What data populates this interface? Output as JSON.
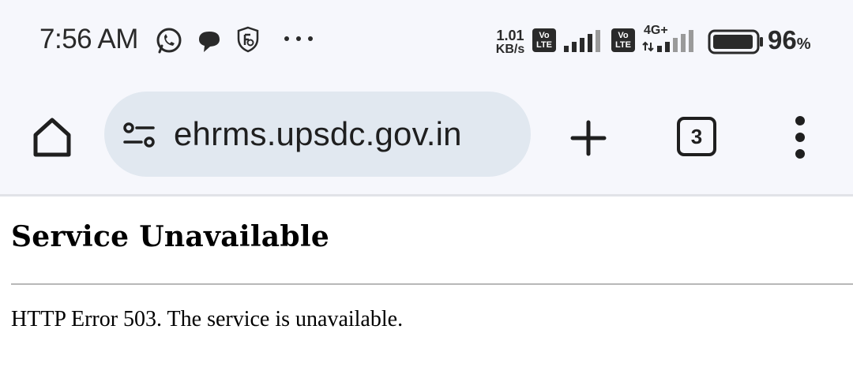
{
  "status_bar": {
    "time": "7:56 AM",
    "notification_icons": [
      "whatsapp-icon",
      "chat-bubble-icon",
      "shield-icon",
      "more-notifications-icon"
    ],
    "network_speed_value": "1.01",
    "network_speed_unit": "KB/s",
    "sim1_badge_top": "Vo",
    "sim1_badge_bottom": "LTE",
    "sim2_badge_top": "Vo",
    "sim2_badge_bottom": "LTE",
    "sim2_network_type": "4G+",
    "battery_level": 96,
    "battery_value": "96",
    "battery_unit": "%"
  },
  "toolbar": {
    "url": "ehrms.upsdc.gov.in",
    "tab_count": "3",
    "icons": [
      "home-icon",
      "site-settings-icon",
      "plus-icon",
      "more-vert-icon"
    ]
  },
  "page": {
    "title": "Service Unavailable",
    "message": "HTTP Error 503. The service is unavailable."
  },
  "colors": {
    "chrome_background": "#f6f7fc",
    "omnibox_background": "#e1e8f0",
    "text": "#1f1f1f"
  }
}
